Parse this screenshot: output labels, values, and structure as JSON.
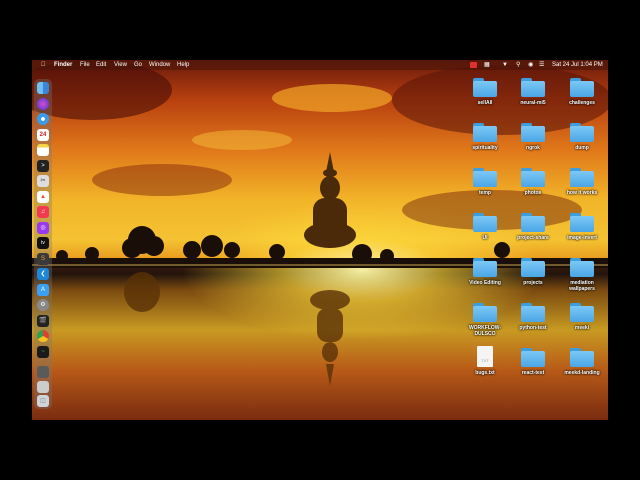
{
  "menubar": {
    "apple_icon": "apple-icon",
    "app_name": "Finder",
    "menus": [
      "File",
      "Edit",
      "View",
      "Go",
      "Window",
      "Help"
    ],
    "clock": "Sat 24 Jul  1:04 PM"
  },
  "dock": {
    "apps": [
      "Finder",
      "Siri",
      "Safari",
      "Calendar",
      "Notes",
      "Terminal",
      "Screenshot",
      "Brave",
      "Music",
      "Podcasts",
      "Apple TV",
      "Sublime Text",
      "VS Code",
      "App Store",
      "System Preferences",
      "Final Cut",
      "Chrome",
      "Activity Monitor",
      "Preview",
      "Finder window",
      "Trash"
    ],
    "calendar_day": "24"
  },
  "desktop": {
    "items": [
      {
        "label": "sellAll",
        "kind": "folder"
      },
      {
        "label": "neural-mi5",
        "kind": "folder"
      },
      {
        "label": "challenges",
        "kind": "folder"
      },
      {
        "label": "spirituality",
        "kind": "folder"
      },
      {
        "label": "ngrok",
        "kind": "folder"
      },
      {
        "label": "dump",
        "kind": "folder"
      },
      {
        "label": "temp",
        "kind": "folder"
      },
      {
        "label": "photos",
        "kind": "folder"
      },
      {
        "label": "how it works",
        "kind": "folder"
      },
      {
        "label": "UI",
        "kind": "folder"
      },
      {
        "label": "project-share",
        "kind": "folder"
      },
      {
        "label": "image-invert",
        "kind": "folder"
      },
      {
        "label": "Video Editing",
        "kind": "folder"
      },
      {
        "label": "projects",
        "kind": "folder"
      },
      {
        "label": "mediation wallpapers",
        "kind": "folder"
      },
      {
        "label": "WORKFLOW-DULSCO",
        "kind": "folder"
      },
      {
        "label": "python-test",
        "kind": "folder"
      },
      {
        "label": "meeki",
        "kind": "folder"
      },
      {
        "label": "bugs.txt",
        "kind": "file",
        "badge": "TXT"
      },
      {
        "label": "react-test",
        "kind": "folder"
      },
      {
        "label": "meekd-landing",
        "kind": "folder"
      }
    ]
  },
  "colors": {
    "folder": "#5ab4ee",
    "menubar": "#461408"
  }
}
